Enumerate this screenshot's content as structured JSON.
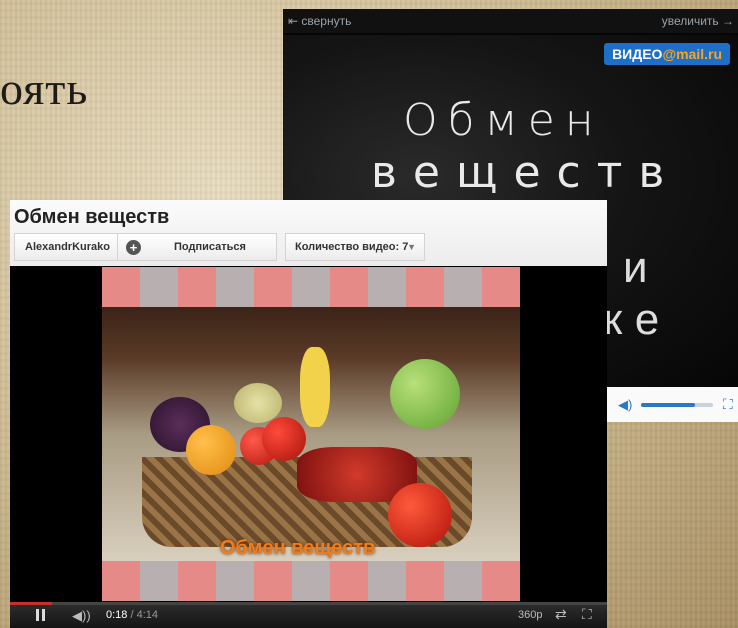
{
  "slide": {
    "title_fragment": "оять"
  },
  "mail_player": {
    "collapse_label": "⇤ свернуть",
    "expand_label": "увеличить →",
    "logo_prefix": "ВИДЕО",
    "logo_at": "@mail.ru",
    "screen_text": [
      "Обмен",
      "веществ",
      "и",
      "ке"
    ],
    "volume_level": 0.75
  },
  "youtube": {
    "title": "Обмен веществ",
    "channel": "AlexandrKurako",
    "subscribe_label": "Подписаться",
    "video_count_label": "Количество видео: 7",
    "caption": "Обмен веществ",
    "time_current": "0:18",
    "time_total": "/ 4:14",
    "progress": 0.07,
    "quality": "360p"
  },
  "colors": {
    "accent_red": "#c4302b",
    "mail_blue": "#1e6fc7",
    "caption_orange": "#f07c1c"
  }
}
